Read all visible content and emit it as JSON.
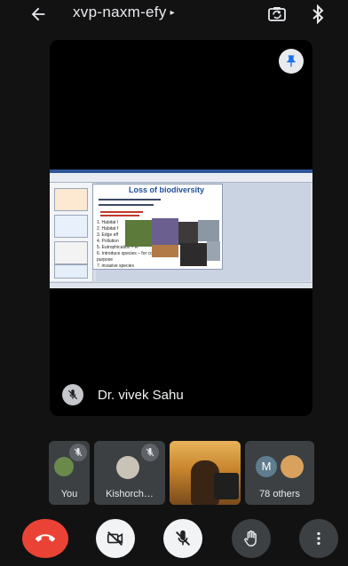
{
  "header": {
    "meeting_code": "xvp-naxm-efy",
    "caret": "▸"
  },
  "main_tile": {
    "speaker_name": "Dr. vivek Sahu",
    "slide": {
      "title": "Loss of biodiversity",
      "list_items": [
        "1. Habitat l",
        "2. Habitat f",
        "3. Edge eff",
        "4. Pollution",
        "5. Eutrophication – A",
        "6. Introduce species – for commer",
        "   purpose",
        "7. invasive species"
      ]
    }
  },
  "participants": [
    {
      "label": "You",
      "muted": true
    },
    {
      "label": "Kishorch…",
      "muted": true
    },
    {
      "label": "",
      "muted": false,
      "video": true
    },
    {
      "label": "78 others",
      "initial": "M"
    }
  ],
  "colors": {
    "end_call": "#ea4335",
    "background": "#121212",
    "tile": "#3c4043"
  }
}
